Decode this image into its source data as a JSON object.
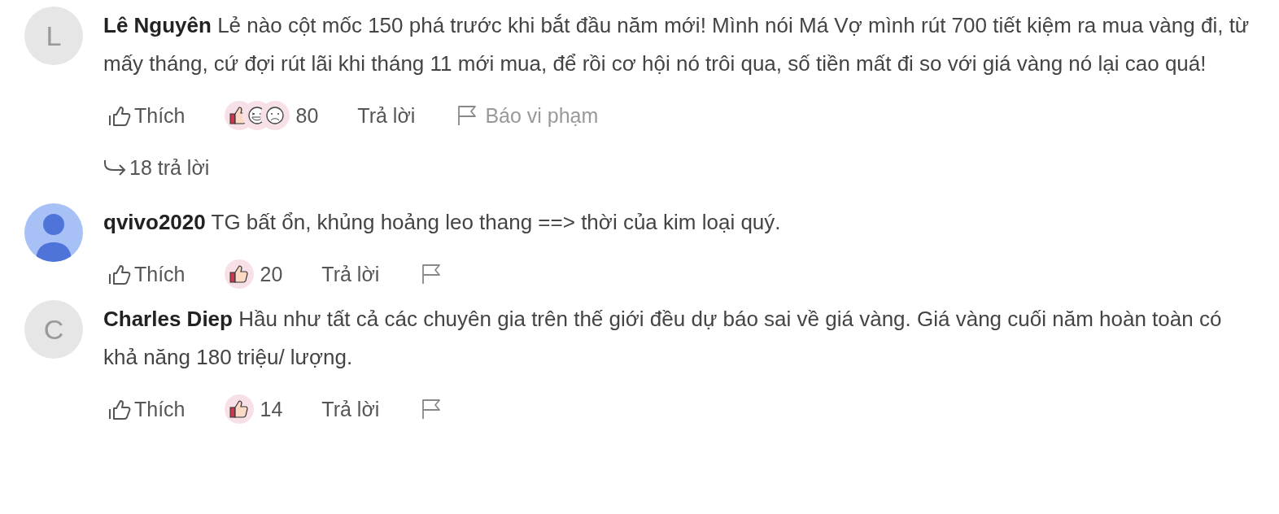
{
  "comments": [
    {
      "avatar": {
        "kind": "letter",
        "letter": "L"
      },
      "author": "Lê Nguyên",
      "text": "Lẻ nào cột mốc 150 phá trước khi bắt đầu năm mới! Mình nói Má Vợ mình rút 700 tiết kiệm ra mua vàng đi, từ mấy tháng, cứ đợi rút lãi khi tháng 11 mới mua, để rồi cơ hội nó trôi qua, số tiền mất đi so với giá vàng nó lại cao quá!",
      "like_label": "Thích",
      "reactions": [
        {
          "kind": "like"
        },
        {
          "kind": "haha"
        },
        {
          "kind": "sad"
        }
      ],
      "reaction_count": "80",
      "reply_label": "Trả lời",
      "report_label": "Báo vi phạm",
      "replies_label": "18 trả lời"
    },
    {
      "avatar": {
        "kind": "user"
      },
      "author": "qvivo2020",
      "text": "TG bất ổn, khủng hoảng leo thang  ==> thời của kim loại quý.",
      "like_label": "Thích",
      "reactions": [
        {
          "kind": "like"
        }
      ],
      "reaction_count": "20",
      "reply_label": "Trả lời"
    },
    {
      "avatar": {
        "kind": "letter",
        "letter": "C"
      },
      "author": "Charles Diep",
      "text": "Hầu như tất cả các chuyên gia trên thế giới đều dự báo sai về giá vàng. Giá vàng cuối năm hoàn toàn có khả năng 180 triệu/ lượng.",
      "like_label": "Thích",
      "reactions": [
        {
          "kind": "like"
        }
      ],
      "reaction_count": "14",
      "reply_label": "Trả lời"
    }
  ]
}
